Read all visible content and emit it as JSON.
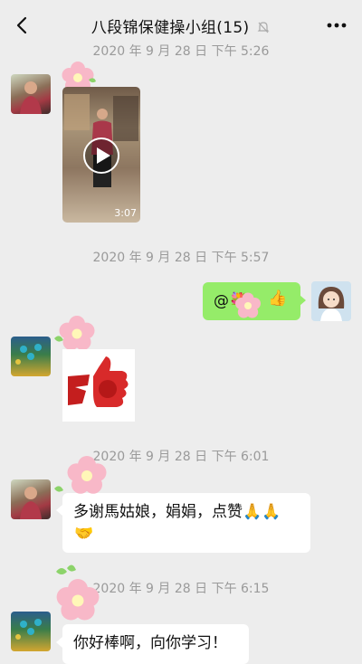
{
  "nav": {
    "back_label": "<",
    "title": "八段锦保健操小组(15)",
    "more_label": "•••"
  },
  "messages": {
    "ts1": "2020 年 9 月 28 日 下午 5:26",
    "video_duration": "3:07",
    "ts2": "2020 年 9 月 28 日 下午 5:57",
    "my_message": "@💐",
    "ts3": "2020 年 9 月 28 日 下午 6:01",
    "msg_thanks": "多谢馬姑娘，娟娟，点赞🙏🙏",
    "ts4": "2020 年 9 月 28 日 下午 6:15",
    "msg_praise": "你好棒啊，向你学习！"
  },
  "colors": {
    "background": "#ededed",
    "my_bubble": "#95ec69",
    "their_bubble": "#ffffff",
    "timestamp": "#9a9a9a"
  },
  "icons": {
    "back": "chevron-left-icon",
    "mute": "bell-muted-icon",
    "more": "more-dots-icon",
    "play": "play-icon",
    "flower": "flower-icon"
  }
}
